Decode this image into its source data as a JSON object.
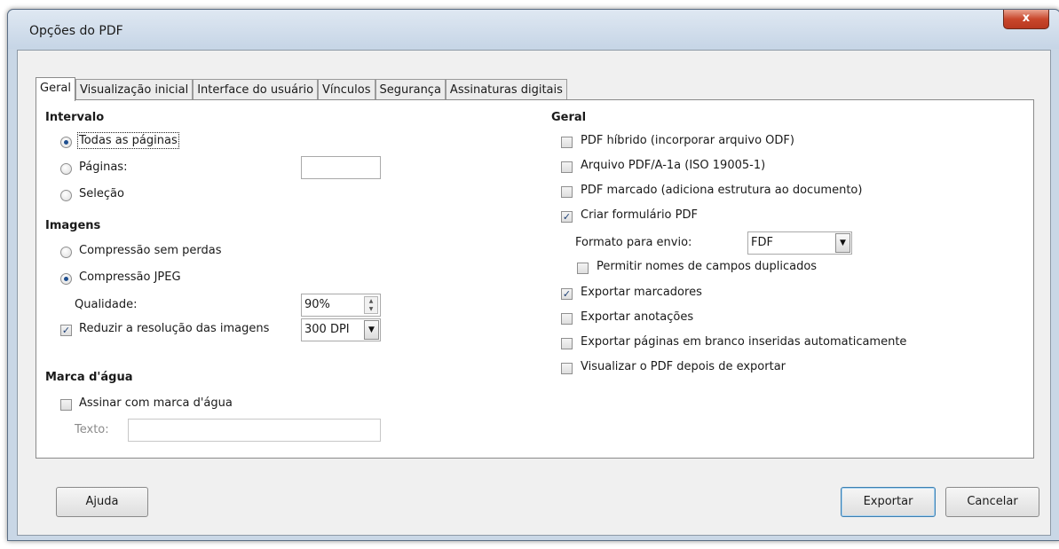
{
  "window": {
    "title": "Opções do PDF",
    "close_label": "x"
  },
  "tabs": [
    {
      "label": "Geral"
    },
    {
      "label": "Visualização inicial"
    },
    {
      "label": "Interface do usuário"
    },
    {
      "label": "Vínculos"
    },
    {
      "label": "Segurança"
    },
    {
      "label": "Assinaturas digitais"
    }
  ],
  "left": {
    "intervalo": {
      "heading": "Intervalo",
      "all_pages": "Todas as páginas",
      "pages": "Páginas:",
      "pages_value": "",
      "selection": "Seleção",
      "selected": "all_pages"
    },
    "imagens": {
      "heading": "Imagens",
      "lossless": "Compressão sem perdas",
      "jpeg": "Compressão JPEG",
      "selected": "jpeg",
      "quality_label": "Qualidade:",
      "quality_value": "90%",
      "reduce_label": "Reduzir a resolução das imagens",
      "reduce_checked": true,
      "resolution_value": "300 DPI"
    },
    "marca": {
      "heading": "Marca d'água",
      "sign_label": "Assinar com marca d'água",
      "sign_checked": false,
      "text_label": "Texto:",
      "text_value": ""
    }
  },
  "right": {
    "heading": "Geral",
    "options": [
      {
        "label": "PDF híbrido (incorporar arquivo ODF)",
        "checked": false
      },
      {
        "label": "Arquivo PDF/A-1a (ISO 19005-1)",
        "checked": false
      },
      {
        "label": "PDF marcado (adiciona estrutura ao documento)",
        "checked": false
      },
      {
        "label": "Criar formulário PDF",
        "checked": true
      }
    ],
    "format_label": "Formato para envio:",
    "format_value": "FDF",
    "duplicate_label": "Permitir nomes de campos duplicados",
    "duplicate_checked": false,
    "options2": [
      {
        "label": "Exportar marcadores",
        "checked": true
      },
      {
        "label": "Exportar anotações",
        "checked": false
      },
      {
        "label": "Exportar páginas em branco inseridas automaticamente",
        "checked": false
      },
      {
        "label": "Visualizar o PDF depois de exportar",
        "checked": false
      }
    ]
  },
  "buttons": {
    "help": "Ajuda",
    "export": "Exportar",
    "cancel": "Cancelar"
  }
}
